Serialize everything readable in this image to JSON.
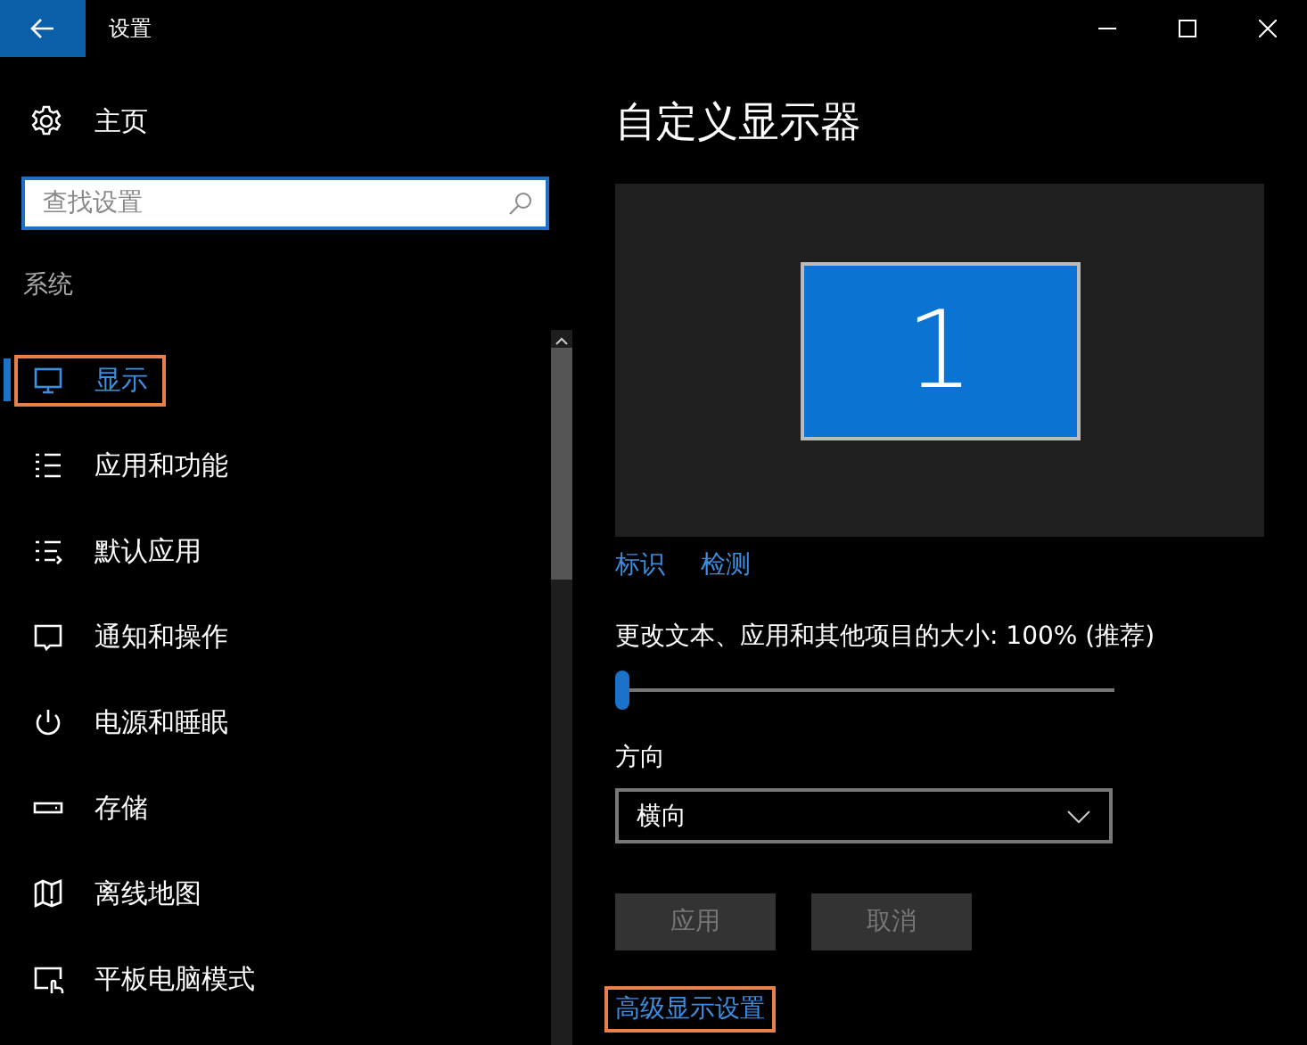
{
  "window": {
    "title": "设置"
  },
  "home": {
    "label": "主页"
  },
  "search": {
    "placeholder": "查找设置"
  },
  "section": "系统",
  "nav": [
    {
      "label": "显示",
      "kind": "monitor",
      "selected": true,
      "highlighted": true
    },
    {
      "label": "应用和功能",
      "kind": "list",
      "selected": false,
      "highlighted": false
    },
    {
      "label": "默认应用",
      "kind": "default",
      "selected": false,
      "highlighted": false
    },
    {
      "label": "通知和操作",
      "kind": "message",
      "selected": false,
      "highlighted": false
    },
    {
      "label": "电源和睡眠",
      "kind": "power",
      "selected": false,
      "highlighted": false
    },
    {
      "label": "存储",
      "kind": "drive",
      "selected": false,
      "highlighted": false
    },
    {
      "label": "离线地图",
      "kind": "map",
      "selected": false,
      "highlighted": false
    },
    {
      "label": "平板电脑模式",
      "kind": "tablet",
      "selected": false,
      "highlighted": false
    }
  ],
  "page": {
    "title": "自定义显示器",
    "display_number": "1",
    "links": [
      "标识",
      "检测"
    ],
    "scale": {
      "label": "更改文本、应用和其他项目的大小: 100% (推荐)",
      "level": 0
    },
    "orientation": {
      "label": "方向",
      "value": "横向"
    },
    "buttons": [
      {
        "label": "应用",
        "disabled": true
      },
      {
        "label": "取消",
        "disabled": true
      }
    ],
    "advanced": {
      "label": "高级显示设置",
      "highlighted": true
    }
  }
}
